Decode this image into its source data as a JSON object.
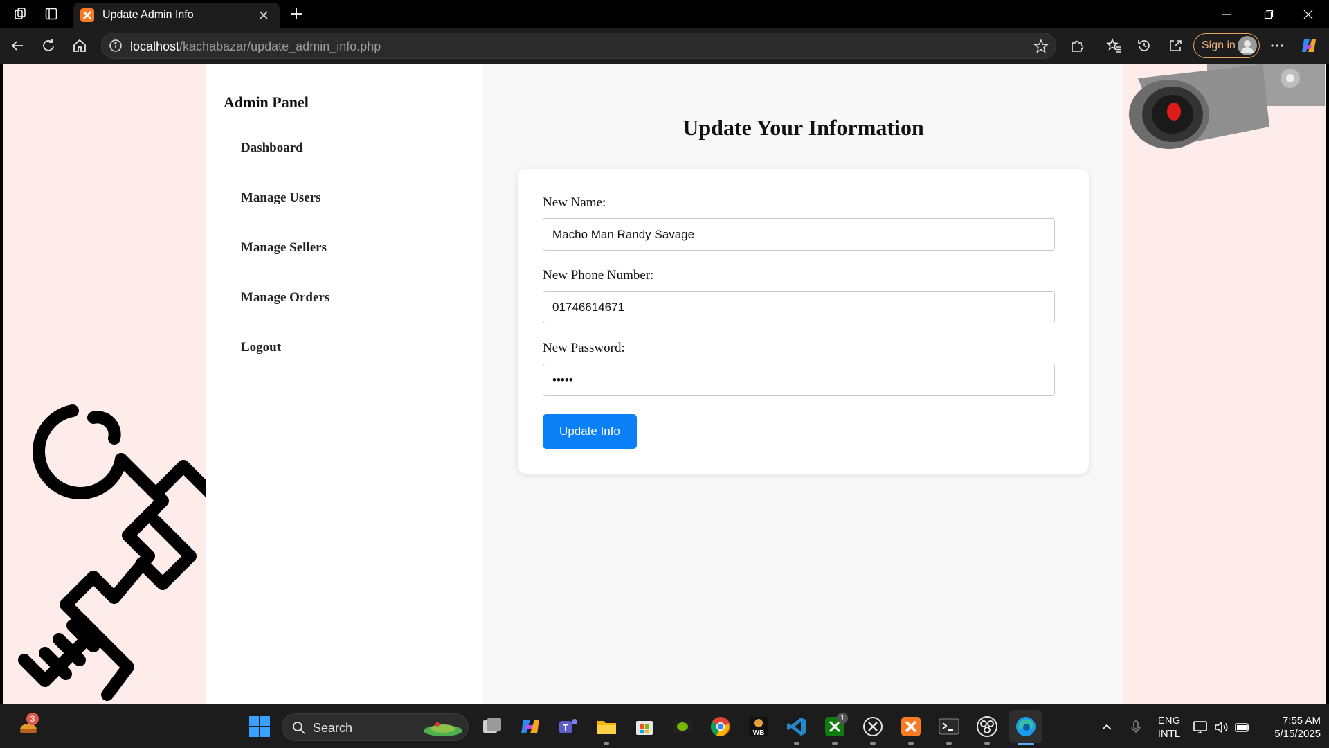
{
  "browser": {
    "tab_title": "Update Admin Info",
    "url_host": "localhost",
    "url_path": "/kachabazar/update_admin_info.php",
    "sign_in_label": "Sign in"
  },
  "sidebar": {
    "title": "Admin Panel",
    "items": [
      {
        "label": "Dashboard"
      },
      {
        "label": "Manage Users"
      },
      {
        "label": "Manage Sellers"
      },
      {
        "label": "Manage Orders"
      },
      {
        "label": "Logout"
      }
    ]
  },
  "main": {
    "title": "Update Your Information",
    "form": {
      "name_label": "New Name:",
      "name_value": "Macho Man Randy Savage",
      "phone_label": "New Phone Number:",
      "phone_value": "01746614671",
      "password_label": "New Password:",
      "password_value": "•••••",
      "submit_label": "Update Info"
    }
  },
  "taskbar": {
    "search_label": "Search",
    "notification_badge": "3",
    "xbox_badge": "1",
    "language_top": "ENG",
    "language_bottom": "INTL",
    "time": "7:55 AM",
    "date": "5/15/2025"
  },
  "colors": {
    "accent_button": "#0b7ff5",
    "page_background": "#fdecea",
    "signin_border": "#e8a25d"
  }
}
